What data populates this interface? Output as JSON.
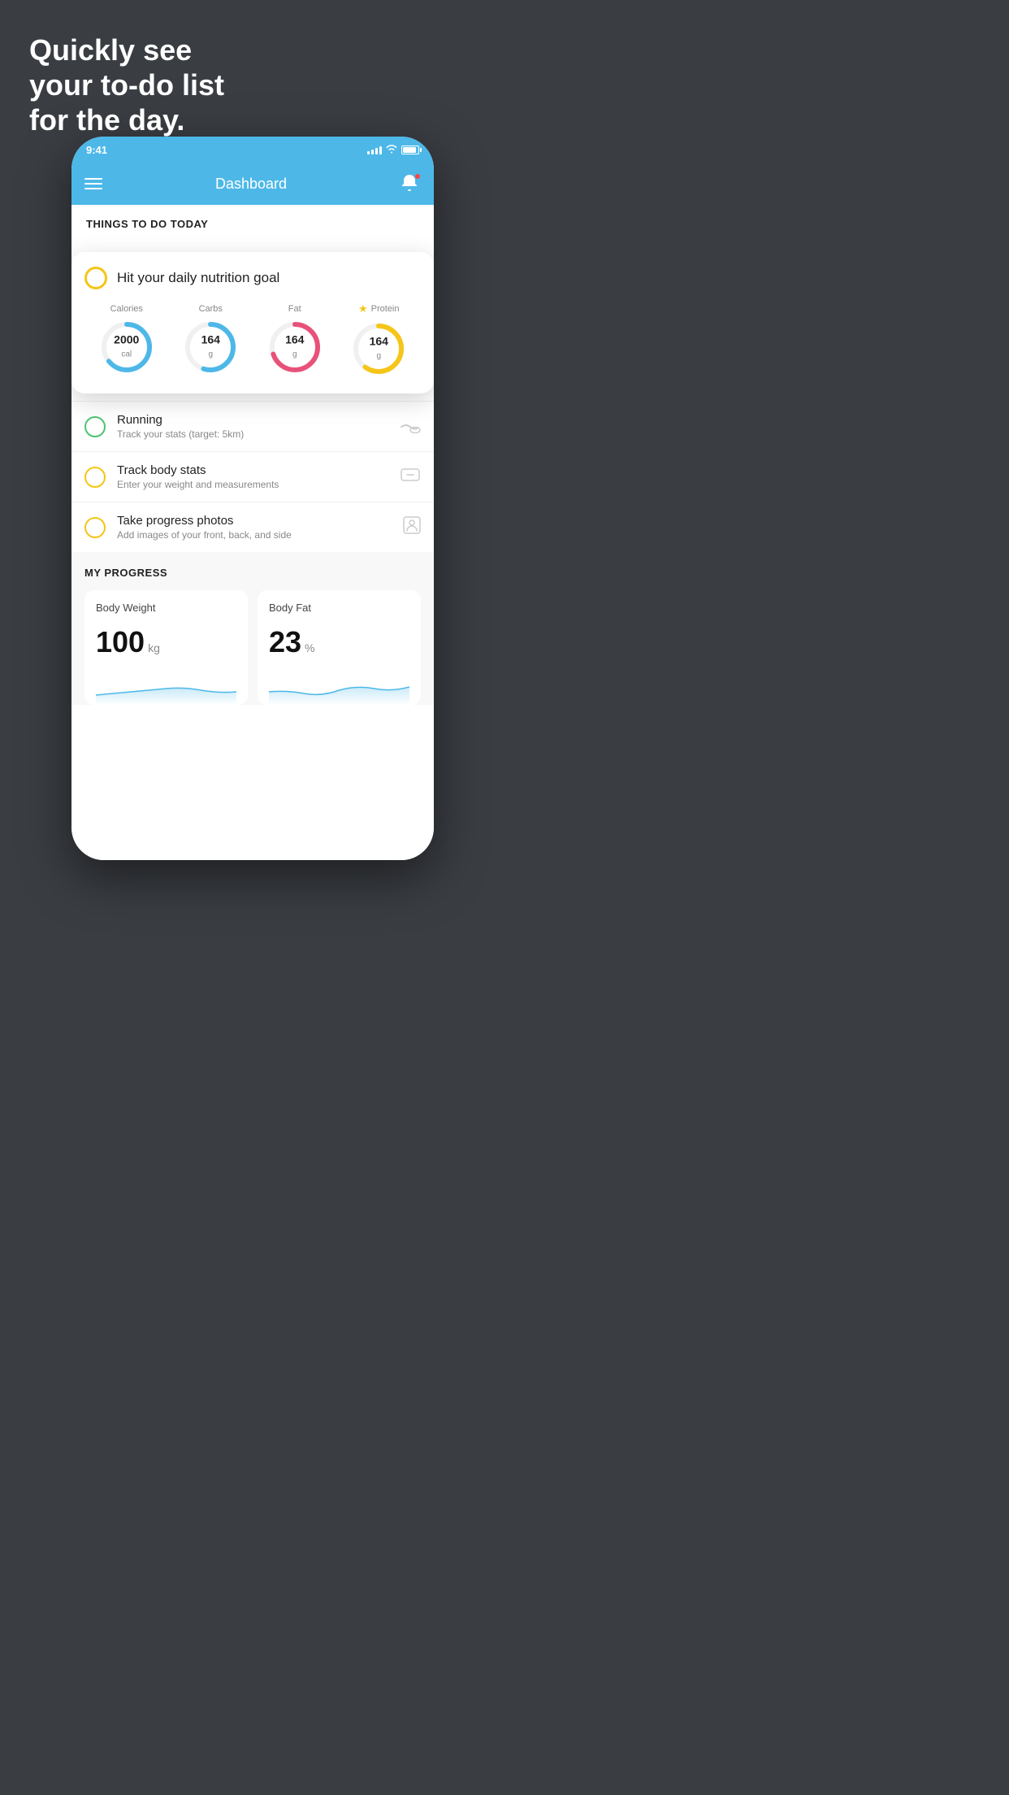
{
  "hero": {
    "line1": "Quickly see",
    "line2": "your to-do list",
    "line3": "for the day."
  },
  "status_bar": {
    "time": "9:41",
    "signal": "4 bars",
    "wifi": "on",
    "battery": "full"
  },
  "nav": {
    "title": "Dashboard"
  },
  "section_heading": "THINGS TO DO TODAY",
  "nutrition_card": {
    "title": "Hit your daily nutrition goal",
    "macros": [
      {
        "label": "Calories",
        "value": "2000",
        "unit": "cal",
        "color": "#4db8e8",
        "percent": 65,
        "star": false
      },
      {
        "label": "Carbs",
        "value": "164",
        "unit": "g",
        "color": "#4db8e8",
        "percent": 55,
        "star": false
      },
      {
        "label": "Fat",
        "value": "164",
        "unit": "g",
        "color": "#e8527a",
        "percent": 70,
        "star": false
      },
      {
        "label": "Protein",
        "value": "164",
        "unit": "g",
        "color": "#f5c518",
        "percent": 60,
        "star": true
      }
    ]
  },
  "todo_items": [
    {
      "id": "running",
      "title": "Running",
      "subtitle": "Track your stats (target: 5km)",
      "circle_color": "green",
      "icon": "👟"
    },
    {
      "id": "track-body-stats",
      "title": "Track body stats",
      "subtitle": "Enter your weight and measurements",
      "circle_color": "yellow",
      "icon": "⚖"
    },
    {
      "id": "progress-photos",
      "title": "Take progress photos",
      "subtitle": "Add images of your front, back, and side",
      "circle_color": "yellow",
      "icon": "👤"
    }
  ],
  "progress": {
    "heading": "MY PROGRESS",
    "cards": [
      {
        "title": "Body Weight",
        "value": "100",
        "unit": "kg"
      },
      {
        "title": "Body Fat",
        "value": "23",
        "unit": "%"
      }
    ]
  }
}
